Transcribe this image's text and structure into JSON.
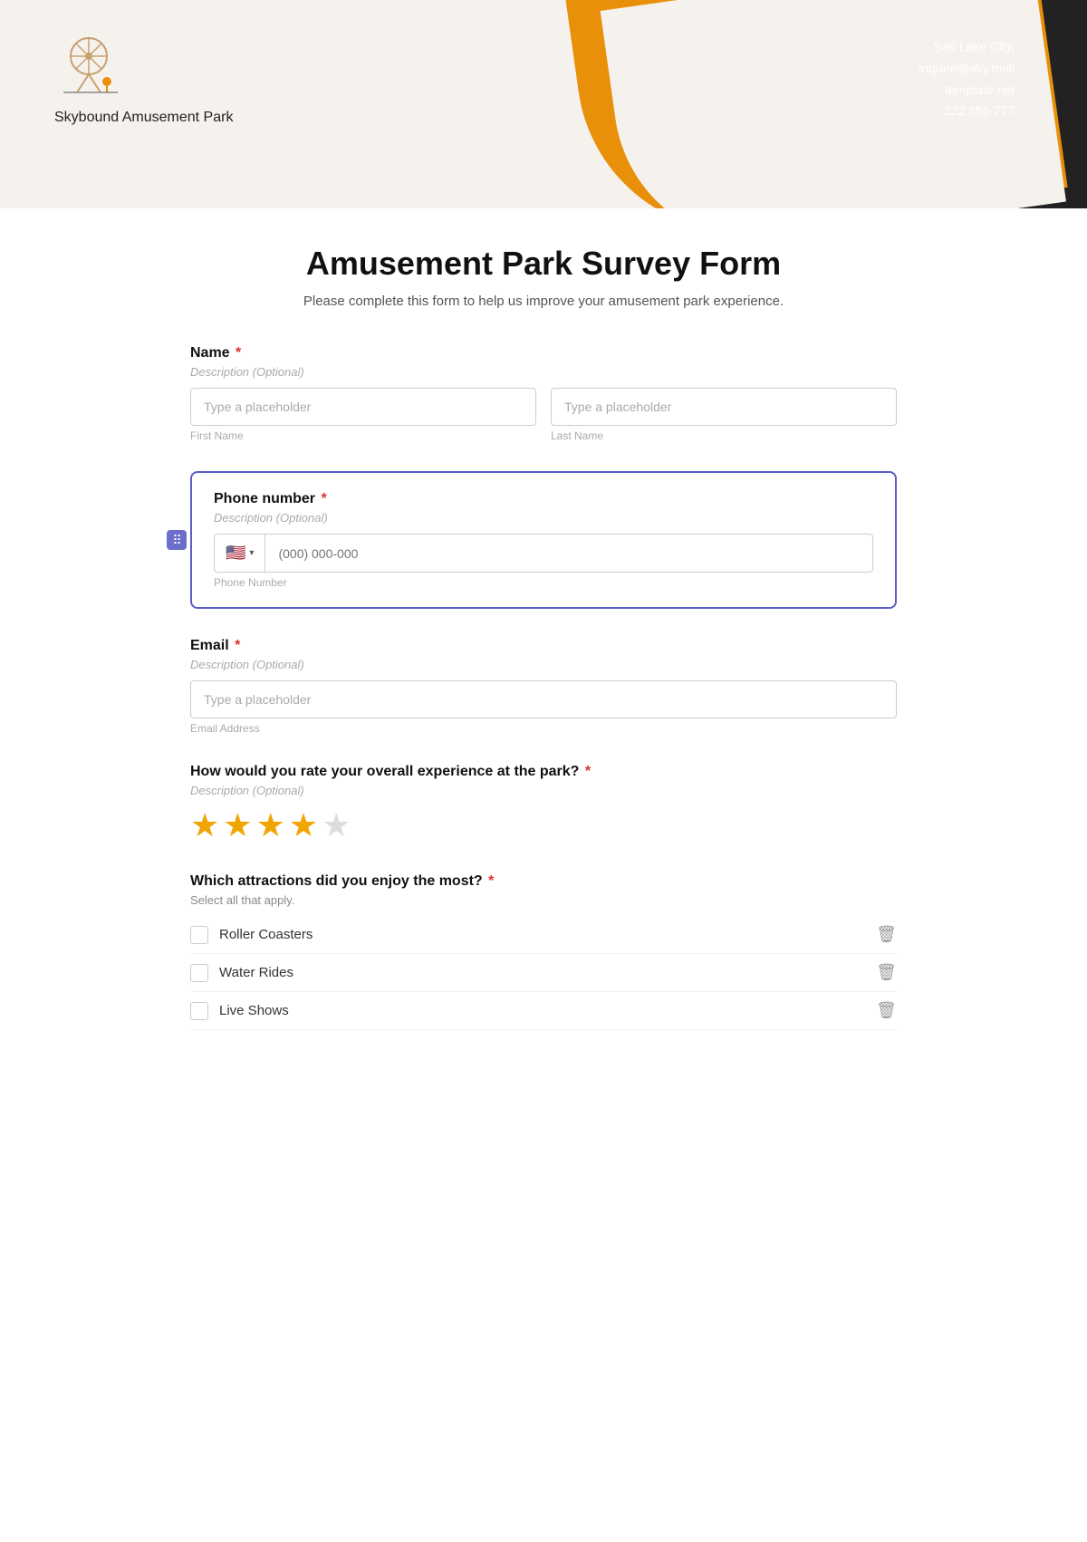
{
  "header": {
    "brand_name": "Skybound Amusement Park",
    "contact_line1": "Salt Lake City,",
    "contact_line2": "inquire@sky.mail",
    "contact_line3": "template.net",
    "contact_line4": "222 555 777"
  },
  "form": {
    "title": "Amusement Park Survey Form",
    "subtitle": "Please complete this form to help us improve your amusement park experience.",
    "fields": {
      "name": {
        "label": "Name",
        "required": true,
        "description": "Description (Optional)",
        "first_placeholder": "Type a placeholder",
        "first_sublabel": "First Name",
        "last_placeholder": "Type a placeholder",
        "last_sublabel": "Last Name"
      },
      "phone": {
        "label": "Phone number",
        "required": true,
        "description": "Description (Optional)",
        "placeholder": "(000) 000-000",
        "sublabel": "Phone Number",
        "flag": "🇺🇸"
      },
      "email": {
        "label": "Email",
        "required": true,
        "description": "Description (Optional)",
        "placeholder": "Type a placeholder",
        "sublabel": "Email Address"
      },
      "rating": {
        "label": "How would you rate your overall experience at the park?",
        "required": true,
        "description": "Description (Optional)",
        "stars": [
          true,
          true,
          true,
          true,
          false
        ]
      },
      "attractions": {
        "label": "Which attractions did you enjoy the most?",
        "required": true,
        "hint": "Select all that apply.",
        "options": [
          "Roller Coasters",
          "Water Rides",
          "Live Shows"
        ]
      }
    }
  }
}
